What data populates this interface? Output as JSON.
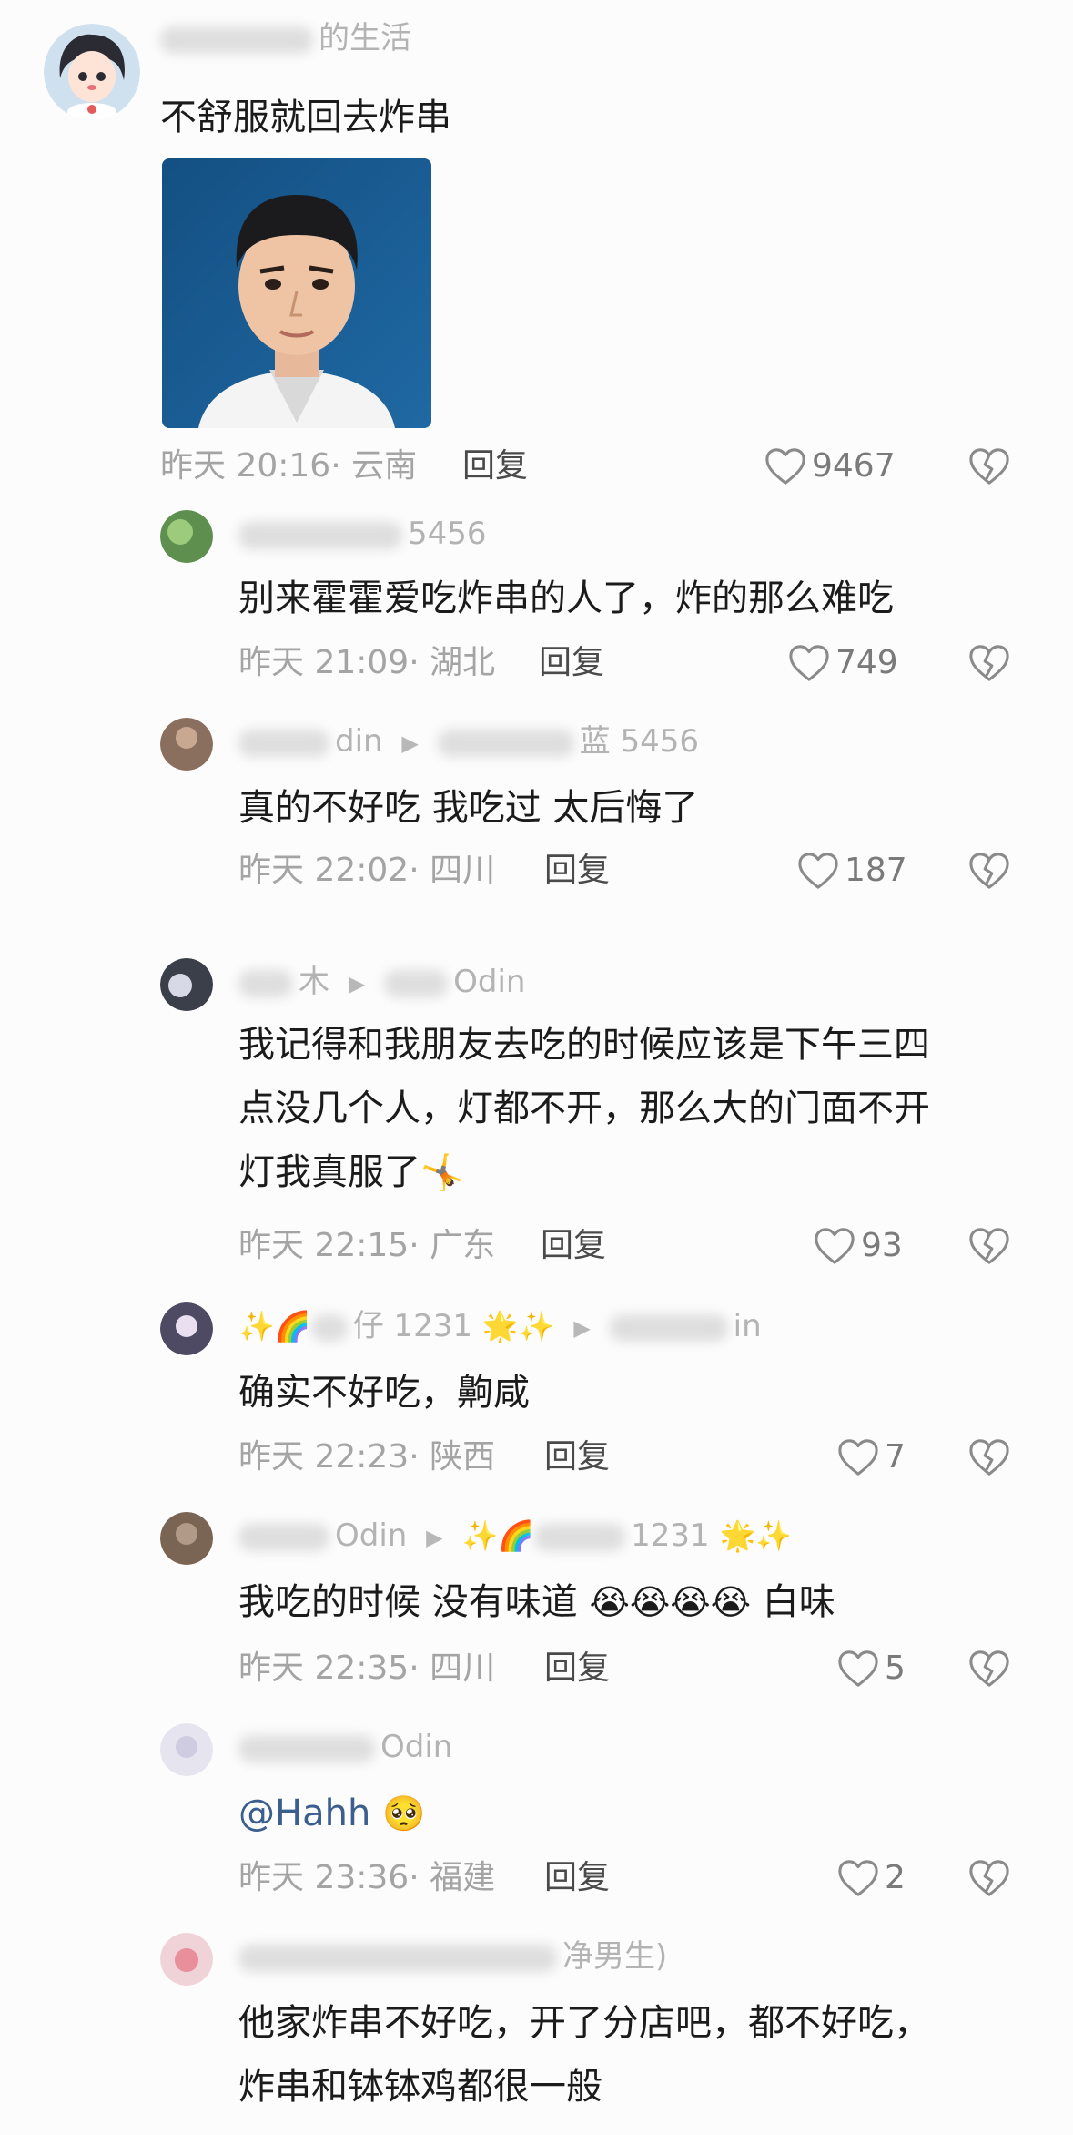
{
  "comments": [
    {
      "name_suffix": "的生活",
      "text": "不舒服就回去炸串",
      "time": "昨天 20:16",
      "location": "云南",
      "reply_label": "回复",
      "likes": "9467"
    },
    {
      "name_suffix": "5456",
      "text": "别来霍霍爱吃炸串的人了，炸的那么难吃",
      "time": "昨天 21:09",
      "location": "湖北",
      "reply_label": "回复",
      "likes": "749"
    },
    {
      "name_suffix": "din",
      "target_suffix": "蓝 5456",
      "text": "真的不好吃 我吃过 太后悔了",
      "time": "昨天 22:02",
      "location": "四川",
      "reply_label": "回复",
      "likes": "187"
    },
    {
      "name_suffix": "木",
      "target_suffix": "Odin",
      "text_lines": [
        "我记得和我朋友去吃的时候应该是下午三四",
        "点没几个人，灯都不开，那么大的门面不开",
        "灯我真服了"
      ],
      "time": "昨天 22:15",
      "location": "广东",
      "reply_label": "回复",
      "likes": "93"
    },
    {
      "name_suffix": "仔 1231",
      "target_suffix": "in",
      "text": "确实不好吃，齁咸",
      "time": "昨天 22:23",
      "location": "陕西",
      "reply_label": "回复",
      "likes": "7"
    },
    {
      "name_suffix": "Odin",
      "target_suffix": "1231",
      "text": "我吃的时候 没有味道",
      "text_tail": "白味",
      "time": "昨天 22:35",
      "location": "四川",
      "reply_label": "回复",
      "likes": "5"
    },
    {
      "name_suffix": "Odin",
      "mention": "@Hahh",
      "time": "昨天 23:36",
      "location": "福建",
      "reply_label": "回复",
      "likes": "2"
    },
    {
      "name_suffix": "净男生)",
      "text_lines": [
        "他家炸串不好吃，开了分店吧，都不好吃，",
        "炸串和钵钵鸡都很一般"
      ]
    }
  ],
  "icons": {
    "like": "heart-outline-icon",
    "dislike": "broken-heart-icon",
    "reply_arrow": "play-triangle-icon",
    "sparkle": "sparkles-emoji",
    "rainbow": "rainbow-emoji",
    "star": "glowing-star-emoji",
    "crying": "loudly-crying-emoji",
    "pleading": "pleading-face-emoji"
  },
  "colors": {
    "background": "#fcfcfc",
    "text": "#1b1b1b",
    "meta": "#a4a4a4",
    "mention": "#3b5e8e"
  }
}
